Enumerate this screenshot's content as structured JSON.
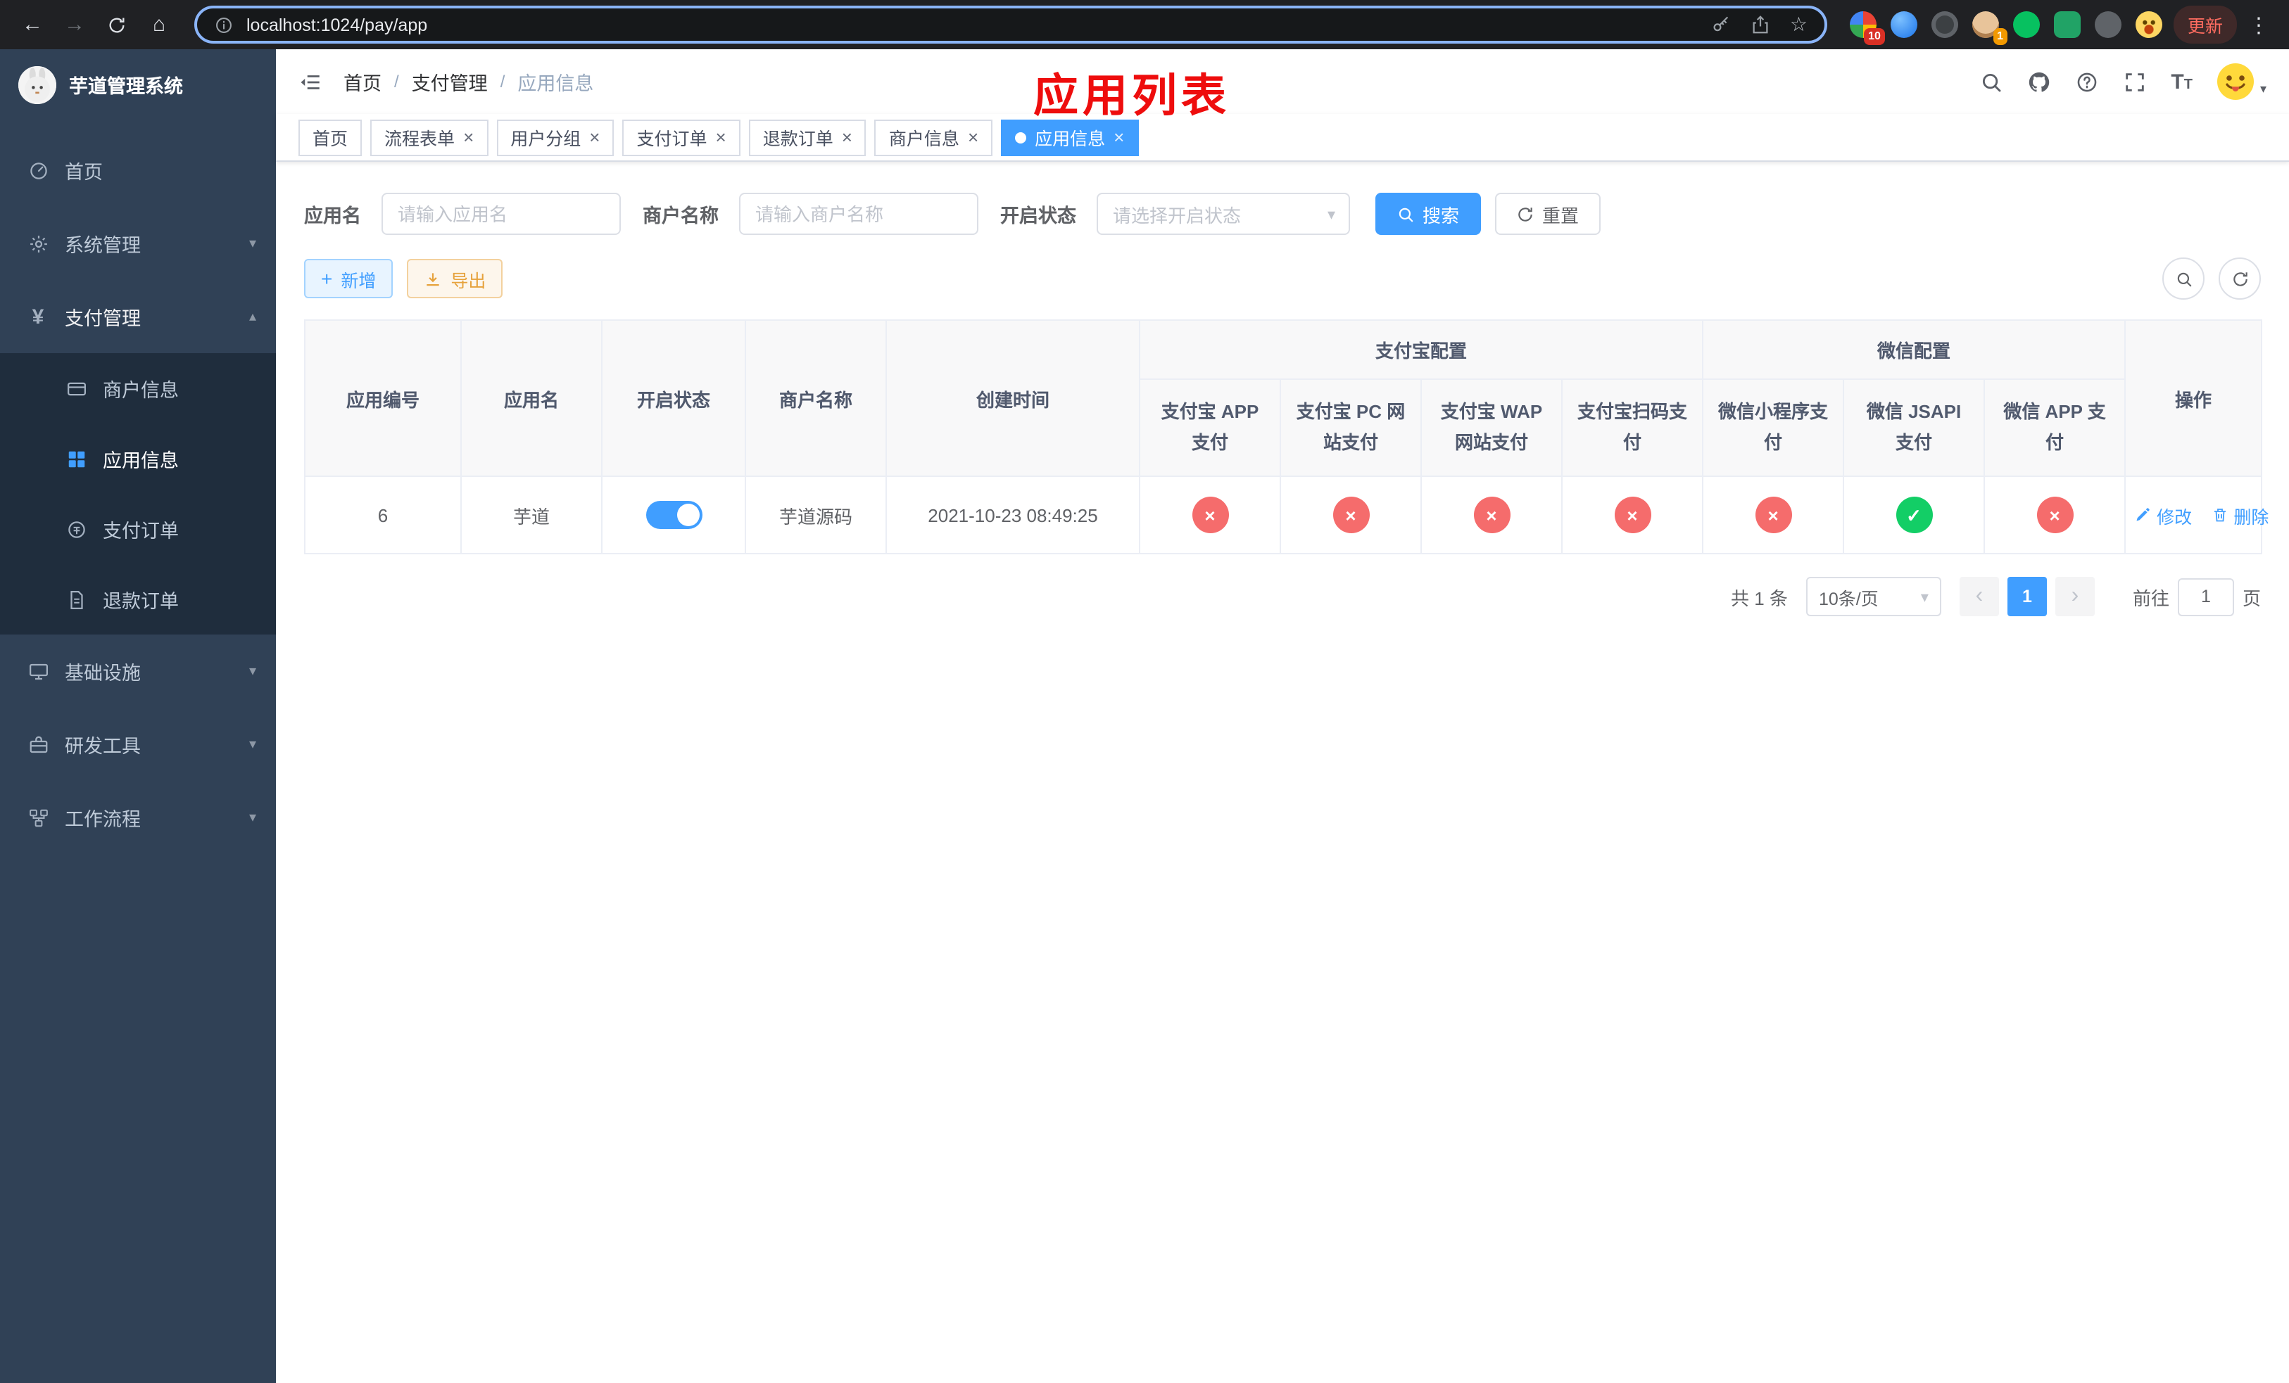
{
  "colors": {
    "primary": "#409eff",
    "success": "#13ce66",
    "danger": "#f56c6c",
    "warning": "#e6a23c",
    "sidebar_bg": "#304156",
    "submenu_bg": "#1f2d3d",
    "annotation_red": "#ee0d0d"
  },
  "glyphs": {
    "back": "←",
    "forward": "→",
    "home": "⌂",
    "star": "☆",
    "dots": "⋮",
    "slash": "/",
    "close": "×",
    "chevron_down": "▾",
    "chevron_up": "▴",
    "prev": "‹",
    "next": "›",
    "plus": "+",
    "check": "✓",
    "cross": "×",
    "yen": "¥",
    "t_large": "T",
    "t_small": "T",
    "caret": "▾"
  },
  "browser": {
    "url": "localhost:1024/pay/app",
    "update_label": "更新",
    "ext_badge_first": "10",
    "ext_badge_avatar": "1"
  },
  "sidebar": {
    "title": "芋道管理系统",
    "items": [
      {
        "label": "首页"
      },
      {
        "label": "系统管理"
      },
      {
        "label": "支付管理"
      },
      {
        "label": "商户信息"
      },
      {
        "label": "应用信息"
      },
      {
        "label": "支付订单"
      },
      {
        "label": "退款订单"
      },
      {
        "label": "基础设施"
      },
      {
        "label": "研发工具"
      },
      {
        "label": "工作流程"
      }
    ]
  },
  "breadcrumb": {
    "items": [
      "首页",
      "支付管理",
      "应用信息"
    ]
  },
  "annotation": "应用列表",
  "tabs": [
    {
      "label": "首页"
    },
    {
      "label": "流程表单"
    },
    {
      "label": "用户分组"
    },
    {
      "label": "支付订单"
    },
    {
      "label": "退款订单"
    },
    {
      "label": "商户信息"
    },
    {
      "label": "应用信息"
    }
  ],
  "filters": {
    "app_name_label": "应用名",
    "app_name_placeholder": "请输入应用名",
    "merchant_label": "商户名称",
    "merchant_placeholder": "请输入商户名称",
    "status_label": "开启状态",
    "status_placeholder": "请选择开启状态",
    "search_label": "搜索",
    "reset_label": "重置"
  },
  "toolbar": {
    "add_label": "新增",
    "export_label": "导出"
  },
  "table": {
    "headers": {
      "app_id": "应用编号",
      "app_name": "应用名",
      "status": "开启状态",
      "merchant": "商户名称",
      "created": "创建时间",
      "alipay_group": "支付宝配置",
      "wechat_group": "微信配置",
      "actions": "操作",
      "sub": [
        "支付宝 APP 支付",
        "支付宝 PC 网站支付",
        "支付宝 WAP 网站支付",
        "支付宝扫码支付",
        "微信小程序支付",
        "微信 JSAPI 支付",
        "微信 APP 支付"
      ]
    },
    "row": {
      "app_id": "6",
      "app_name": "芋道",
      "enabled": true,
      "merchant": "芋道源码",
      "created": "2021-10-23 08:49:25",
      "config_statuses": [
        false,
        false,
        false,
        false,
        false,
        true,
        false
      ],
      "edit_label": "修改",
      "delete_label": "删除"
    }
  },
  "pagination": {
    "total": "共 1 条",
    "page_size": "10条/页",
    "current": "1",
    "goto_prefix": "前往",
    "goto_value": "1",
    "goto_suffix": "页"
  }
}
